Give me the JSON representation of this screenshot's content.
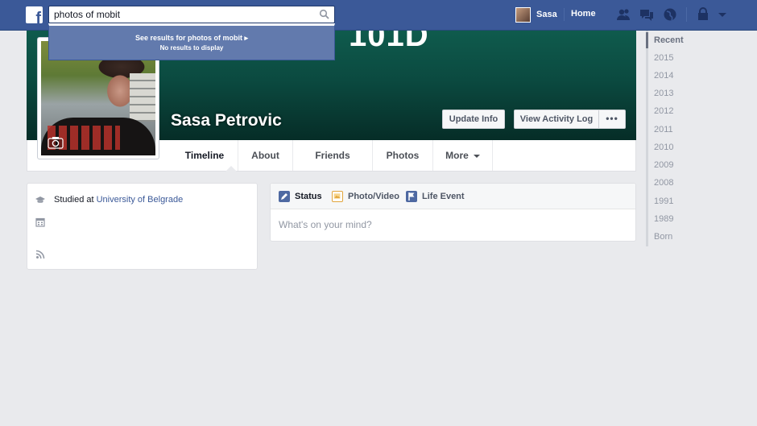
{
  "topbar": {
    "logo_letter": "f",
    "search_value": "photos of mobit",
    "user_name": "Sasa",
    "home_label": "Home"
  },
  "search_dropdown": {
    "see_results": "See results for photos of mobit",
    "no_results": "No results to display"
  },
  "cover": {
    "overlay_text": "101D",
    "name": "Sasa Petrovic",
    "update_info_label": "Update Info",
    "activity_log_label": "View Activity Log",
    "more_dots_label": "•••"
  },
  "tabs": [
    {
      "label": "Timeline"
    },
    {
      "label": "About"
    },
    {
      "label": "Friends"
    },
    {
      "label": "Photos"
    },
    {
      "label": "More"
    }
  ],
  "info": {
    "studied_prefix": "Studied at ",
    "school": "University of Belgrade"
  },
  "composer": {
    "tabs": [
      {
        "label": "Status",
        "icon": "pencil-icon",
        "color": "#4e69a2"
      },
      {
        "label": "Photo/Video",
        "icon": "photo-icon",
        "color": "#e2a53d"
      },
      {
        "label": "Life Event",
        "icon": "flag-icon",
        "color": "#4e69a2"
      }
    ],
    "placeholder": "What's on your mind?"
  },
  "years": [
    "Recent",
    "2015",
    "2014",
    "2013",
    "2012",
    "2011",
    "2010",
    "2009",
    "2008",
    "1991",
    "1989",
    "Born"
  ],
  "colors": {
    "brand": "#3b5998",
    "cover": "#0b4a40",
    "link": "#3b5998"
  }
}
